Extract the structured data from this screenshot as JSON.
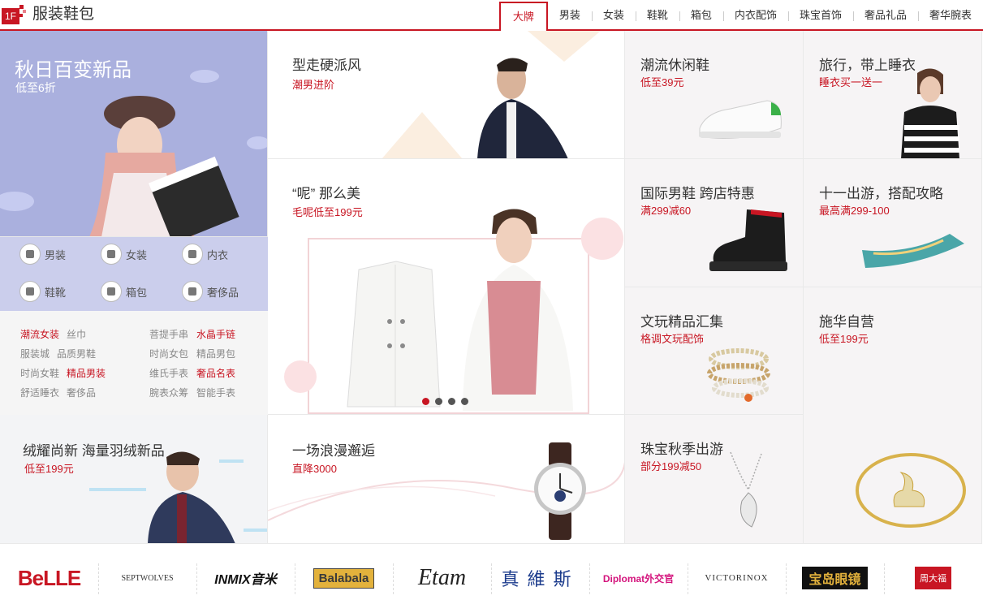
{
  "floor": {
    "badge": "1F",
    "title": "服装鞋包"
  },
  "tabs": [
    "大牌",
    "男装",
    "女装",
    "鞋靴",
    "箱包",
    "内衣配饰",
    "珠宝首饰",
    "奢品礼品",
    "奢华腕表"
  ],
  "left_banner": {
    "title": "秋日百变新品",
    "sub": "低至6折"
  },
  "categories": [
    {
      "label": "男装",
      "icon": "shirt-icon"
    },
    {
      "label": "女装",
      "icon": "dress-icon"
    },
    {
      "label": "内衣",
      "icon": "underwear-icon"
    },
    {
      "label": "鞋靴",
      "icon": "boot-icon"
    },
    {
      "label": "箱包",
      "icon": "bag-icon"
    },
    {
      "label": "奢侈品",
      "icon": "diamond-icon"
    }
  ],
  "links": [
    {
      "text": "潮流女装",
      "hot": true
    },
    {
      "text": "丝巾",
      "hot": false
    },
    {
      "text": "菩提手串",
      "hot": false
    },
    {
      "text": "水晶手链",
      "hot": true
    },
    {
      "text": "服装城",
      "hot": false
    },
    {
      "text": "品质男鞋",
      "hot": false
    },
    {
      "text": "时尚女包",
      "hot": false
    },
    {
      "text": "精品男包",
      "hot": false
    },
    {
      "text": "时尚女鞋",
      "hot": false
    },
    {
      "text": "精品男装",
      "hot": true
    },
    {
      "text": "维氏手表",
      "hot": false
    },
    {
      "text": "奢品名表",
      "hot": true
    },
    {
      "text": "舒适睡衣",
      "hot": false
    },
    {
      "text": "奢侈品",
      "hot": false
    },
    {
      "text": "腕表众筹",
      "hot": false
    },
    {
      "text": "智能手表",
      "hot": false
    }
  ],
  "left_bottom": {
    "title": "绒耀尚新 海量羽绒新品",
    "sub": "低至199元"
  },
  "mid_top": {
    "title": "型走硬派风",
    "sub": "潮男进阶"
  },
  "mid_main": {
    "title": "“呢” 那么美",
    "sub": "毛呢低至199元",
    "slides": 4,
    "active_slide": 1
  },
  "mid_bottom": {
    "title": "一场浪漫邂逅",
    "sub": "直降3000"
  },
  "cells": {
    "r1": {
      "title": "潮流休闲鞋",
      "sub": "低至39元"
    },
    "r2": {
      "title": "旅行，带上睡衣",
      "sub": "睡衣买一送一"
    },
    "r3": {
      "title": "国际男鞋 跨店特惠",
      "sub": "满299减60"
    },
    "r4": {
      "title": "十一出游，搭配攻略",
      "sub": "最高满299-100"
    },
    "r5": {
      "title": "文玩精品汇集",
      "sub": "格调文玩配饰"
    },
    "r6": {
      "title": "施华自营",
      "sub": "低至199元"
    },
    "r7": {
      "title": "珠宝秋季出游",
      "sub": "部分199减50"
    }
  },
  "brands": [
    {
      "name": "BeLLE",
      "color": "#c81623"
    },
    {
      "name": "SEPTWOLVES",
      "color": "#333333"
    },
    {
      "name": "INMIX音米",
      "color": "#111111"
    },
    {
      "name": "Balabala",
      "color": "#3a3a3a"
    },
    {
      "name": "Etam",
      "color": "#222222"
    },
    {
      "name": "真維斯",
      "color": "#1b3b8c"
    },
    {
      "name": "Diplomat外交官",
      "color": "#d4137c"
    },
    {
      "name": "VICTORINOX",
      "color": "#333333"
    },
    {
      "name": "宝岛眼镜",
      "color": "#c81623"
    },
    {
      "name": "周大福",
      "color": "#c81623"
    }
  ],
  "colors": {
    "accent": "#c81623",
    "left_banner_bg": "#aab0de"
  }
}
